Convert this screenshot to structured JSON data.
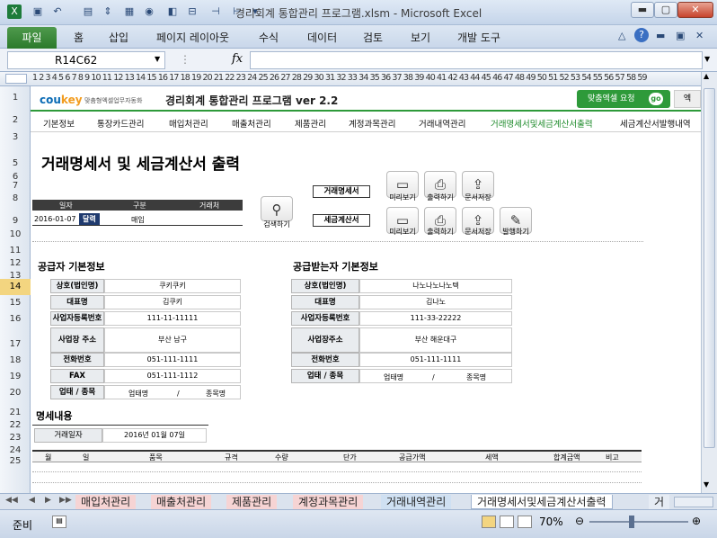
{
  "window": {
    "title": "경리회계 통합관리 프로그램.xlsm - Microsoft Excel"
  },
  "ribbon": {
    "file_tab": "파일",
    "tabs": [
      "홈",
      "삽입",
      "페이지 레이아웃",
      "수식",
      "데이터",
      "검토",
      "보기",
      "개발 도구"
    ]
  },
  "formula_bar": {
    "name_box": "R14C62",
    "fx": "fx",
    "formula": ""
  },
  "columns": "1 2 3 4 5 6 7 8 9 10 11 12 13 14 15 16 17 18 19 20 21 22 23 24 25 26 27 28 29 30 31 32 33 34 35 36 37 38 39 40 41 42 43 44 45 46 47 48 49 50 51 52 53 54 55 56 57 58 59",
  "rows": [
    "1",
    "2",
    "3",
    "5",
    "6",
    "7",
    "8",
    "9",
    "10",
    "11",
    "12",
    "13",
    "14",
    "15",
    "16",
    "17",
    "18",
    "19",
    "20",
    "21",
    "22",
    "23",
    "24",
    "25"
  ],
  "selected_row": "14",
  "header": {
    "logo_co": "cou",
    "logo_key": "key",
    "logo_sub": "맞춤형엑셀업무자동화",
    "program_title": "경리회계 통합관리 프로그램 ver 2.2",
    "request_button": "맞춤엑셀 요청",
    "go": "go",
    "extra": "엑"
  },
  "menu": [
    "기본정보",
    "통장카드관리",
    "매입처관리",
    "매출처관리",
    "제품관리",
    "계정과목관리",
    "거래내역관리",
    "거래명세서및세금계산서출력",
    "세금계산서발행내역"
  ],
  "page_title": "거래명세서 및 세금계산서 출력",
  "search_table": {
    "headers": [
      "일자",
      "구분",
      "거래처"
    ],
    "date": "2016-01-07",
    "type_button": "달력",
    "type": "매입",
    "client": ""
  },
  "search_button": "검색하기",
  "doc_labels": {
    "statement": "거래명세서",
    "tax_invoice": "세금계산서"
  },
  "actions": {
    "preview": "미리보기",
    "print": "출력하기",
    "save": "문서저장",
    "issue": "발행하기"
  },
  "supplier": {
    "title": "공급자 기본정보",
    "rows": [
      {
        "label": "상호(법인명)",
        "value": "쿠키쿠키"
      },
      {
        "label": "대표명",
        "value": "김쿠키"
      },
      {
        "label": "사업자등록번호",
        "value": "111-11-11111"
      },
      {
        "label": "사업장 주소",
        "value": "부산 남구"
      },
      {
        "label": "전화번호",
        "value": "051-111-1111"
      },
      {
        "label": "FAX",
        "value": "051-111-1112"
      }
    ],
    "biz_label": "업태 / 종목",
    "biz_type": "업태명",
    "biz_sep": "/",
    "biz_item": "종목명"
  },
  "receiver": {
    "title": "공급받는자 기본정보",
    "rows": [
      {
        "label": "상호(법인명)",
        "value": "나노나노나노텍"
      },
      {
        "label": "대표명",
        "value": "김나노"
      },
      {
        "label": "사업자등록번호",
        "value": "111-33-22222"
      },
      {
        "label": "사업장주소",
        "value": "부산 해운대구"
      },
      {
        "label": "전화번호",
        "value": "051-111-1111"
      }
    ],
    "biz_label": "업태 / 종목",
    "biz_type": "업태명",
    "biz_sep": "/",
    "biz_item": "종목명"
  },
  "details": {
    "title": "명세내용",
    "date_label": "거래일자",
    "date_value": "2016년 01월 07일",
    "columns": [
      "월",
      "일",
      "품목",
      "규격",
      "수량",
      "단가",
      "공급가액",
      "세액",
      "합계금액",
      "비고"
    ]
  },
  "sheet_tabs": [
    "매입처관리",
    "매출처관리",
    "제품관리",
    "계정과목관리",
    "거래내역관리",
    "거래명세서및세금계산서출력",
    "거"
  ],
  "active_sheet_tab": "거래명세서및세금계산서출력",
  "status": {
    "ready": "준비",
    "zoom": "70%"
  },
  "colors": {
    "accent_green": "#2e9a3a",
    "menu_active": "#1d8a2a",
    "excel_file_tab": "#2b7a2b",
    "selected_row": "#f3d580"
  }
}
